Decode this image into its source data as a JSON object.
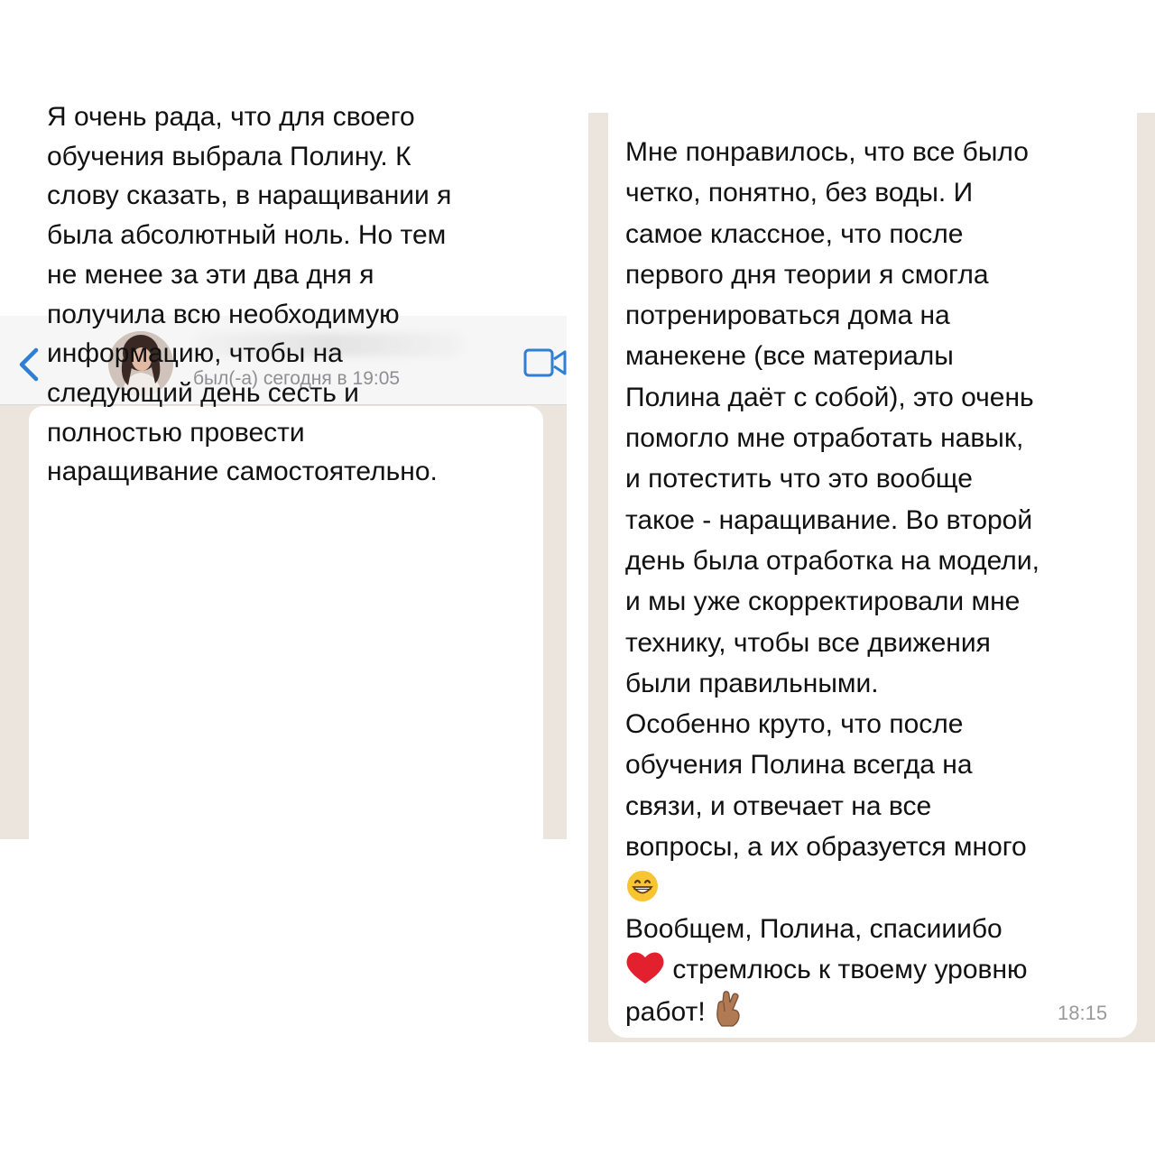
{
  "left_chat": {
    "header": {
      "back_icon": "chevron-left-icon",
      "last_seen": "был(-а) сегодня в 19:05",
      "video_icon": "video-camera-icon"
    },
    "message": {
      "text": "Я очень рада, что для своего\nобучения выбрала Полину. К\nслову сказать, в наращивании я\nбыла абсолютный ноль. Но тем\nне менее за эти два дня я\nполучила всю необходимую\nинформацию, чтобы на\nследующий день сесть и\nполностью провести\nнаращивание самостоятельно."
    }
  },
  "right_chat": {
    "message": {
      "lines": [
        "Мне понравилось, что все  было",
        "четко, понятно, без воды. И",
        "самое классное, что после",
        "первого дня теории я смогла",
        "потренироваться дома на",
        "манекене (все материалы",
        "Полина даёт с собой), это очень",
        "помогло мне отработать навык,",
        "и потестить что это вообще",
        "такое - наращивание. Во второй",
        "день  была отработка на модели,",
        "и мы уже скорректировали мне",
        "технику, чтобы все движения",
        "были правильными.",
        "Особенно круто, что после",
        "обучения Полина всегда на",
        "связи, и отвечает на все",
        "вопросы, а их образуется много",
        "Вообщем, Полина, спасииибо",
        "стремлюсь к твоему уровню",
        "работ!"
      ],
      "emoji_grin": "grinning-face-emoji",
      "emoji_heart": "red-heart-emoji",
      "emoji_fingers": "crossed-fingers-emoji",
      "time": "18:15"
    }
  },
  "colors": {
    "chat_background": "#ebe5de",
    "bubble": "#ffffff",
    "accent_blue": "#2f7fd4",
    "meta_gray": "#8e8e93"
  }
}
